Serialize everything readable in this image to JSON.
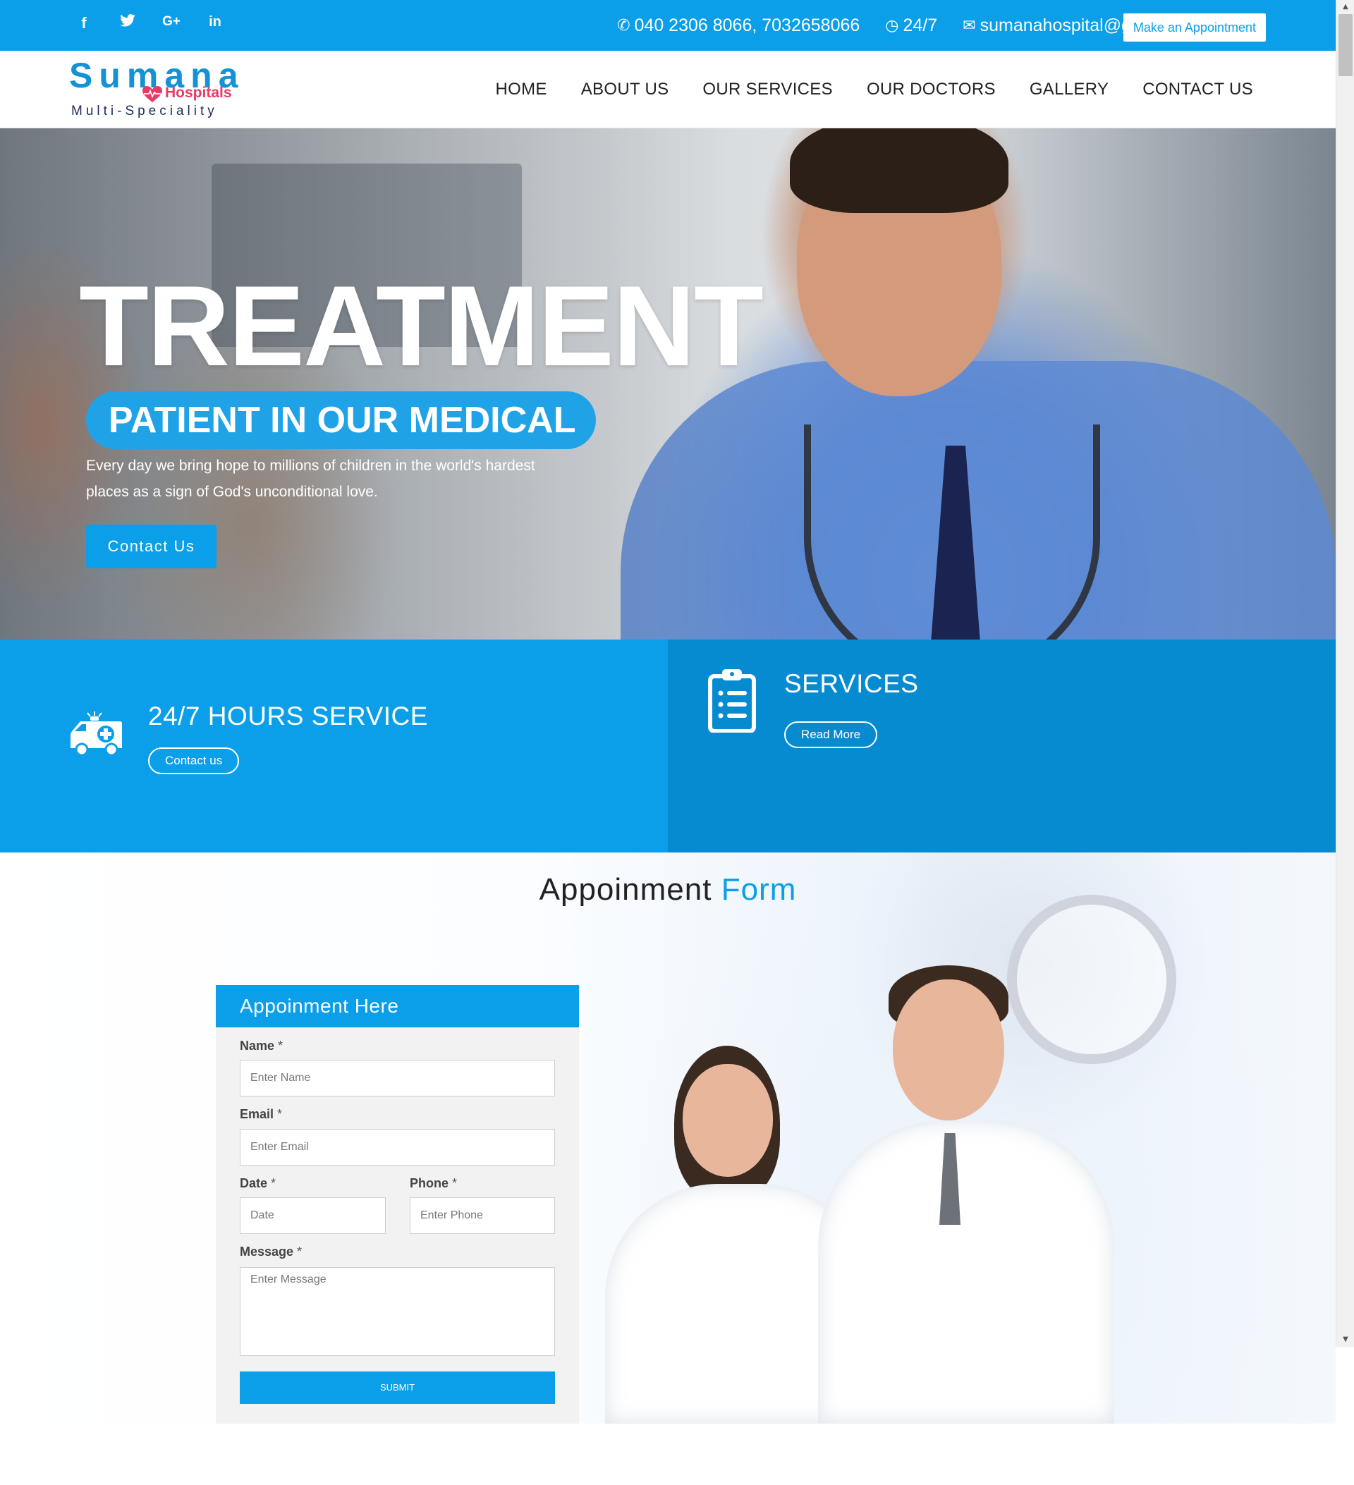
{
  "topbar": {
    "social": [
      {
        "icon": "facebook-icon",
        "glyph": "f"
      },
      {
        "icon": "twitter-icon",
        "glyph": "🐦"
      },
      {
        "icon": "google-plus-icon",
        "glyph": "G+"
      },
      {
        "icon": "linkedin-icon",
        "glyph": "in"
      }
    ],
    "phone": "040 2306 8066, 7032658066",
    "hours": "24/7",
    "email": "sumanahospital@gmail.com",
    "appointment_button": "Make an Appointment"
  },
  "logo": {
    "name": "Sumana",
    "hospitals": "Hospitals",
    "tagline": "Multi-Speciality"
  },
  "nav": [
    "HOME",
    "ABOUT US",
    "OUR SERVICES",
    "OUR DOCTORS",
    "GALLERY",
    "CONTACT US"
  ],
  "hero": {
    "title": "TREATMENT",
    "subtitle": "PATIENT IN OUR MEDICAL",
    "text": "Every day we bring hope to millions of children in the world's hardest places as a sign of God's unconditional love.",
    "button": "Contact Us"
  },
  "services_strip": {
    "left": {
      "icon": "ambulance-icon",
      "title": "24/7 HOURS SERVICE",
      "button": "Contact us"
    },
    "right": {
      "icon": "clipboard-icon",
      "title": "SERVICES",
      "button": "Read More"
    }
  },
  "appointment_section": {
    "title_main": "Appoinment",
    "title_accent": "Form"
  },
  "form": {
    "header": "Appoinment Here",
    "name_label": "Name",
    "name_placeholder": "Enter Name",
    "email_label": "Email",
    "email_placeholder": "Enter Email",
    "date_label": "Date",
    "date_placeholder": "Date",
    "phone_label": "Phone",
    "phone_placeholder": "Enter Phone",
    "message_label": "Message",
    "message_placeholder": "Enter Message",
    "required_mark": "*",
    "submit": "SUBMIT"
  },
  "colors": {
    "primary": "#0a9fe8",
    "primary_dark": "#078bd0",
    "logo_blue": "#1393d6",
    "logo_pink": "#e83a66"
  }
}
